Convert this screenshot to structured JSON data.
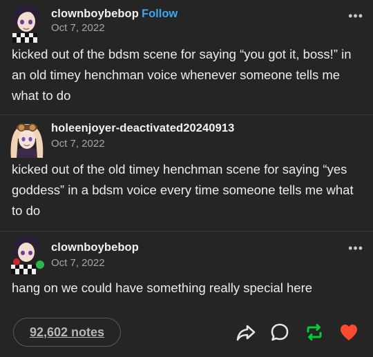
{
  "posts": [
    {
      "username": "clownboybebop",
      "follow_label": "Follow",
      "date": "Oct 7, 2022",
      "more_label": "•••",
      "text": "kicked out of the bdsm scene for saying “you got it, boss!” in an old timey henchman voice whenever someone tells me what to do"
    },
    {
      "username": "holeenjoyer-deactivated20240913",
      "date": "Oct 7, 2022",
      "text": "kicked out of the old timey henchman scene for saying “yes goddess” in a bdsm voice every time someone tells me what to do"
    },
    {
      "username": "clownboybebop",
      "date": "Oct 7, 2022",
      "more_label": "•••",
      "text": "hang on we could have something  really special here"
    }
  ],
  "footer": {
    "notes_label": "92,602 notes"
  },
  "icons": {
    "share": "share-icon",
    "reply": "reply-icon",
    "reblog": "reblog-icon",
    "like": "heart-icon"
  },
  "colors": {
    "background": "#252525",
    "follow": "#3fa7ee",
    "reblog": "#00cf35",
    "like": "#ff4930",
    "divider": "#3a3a3a"
  }
}
